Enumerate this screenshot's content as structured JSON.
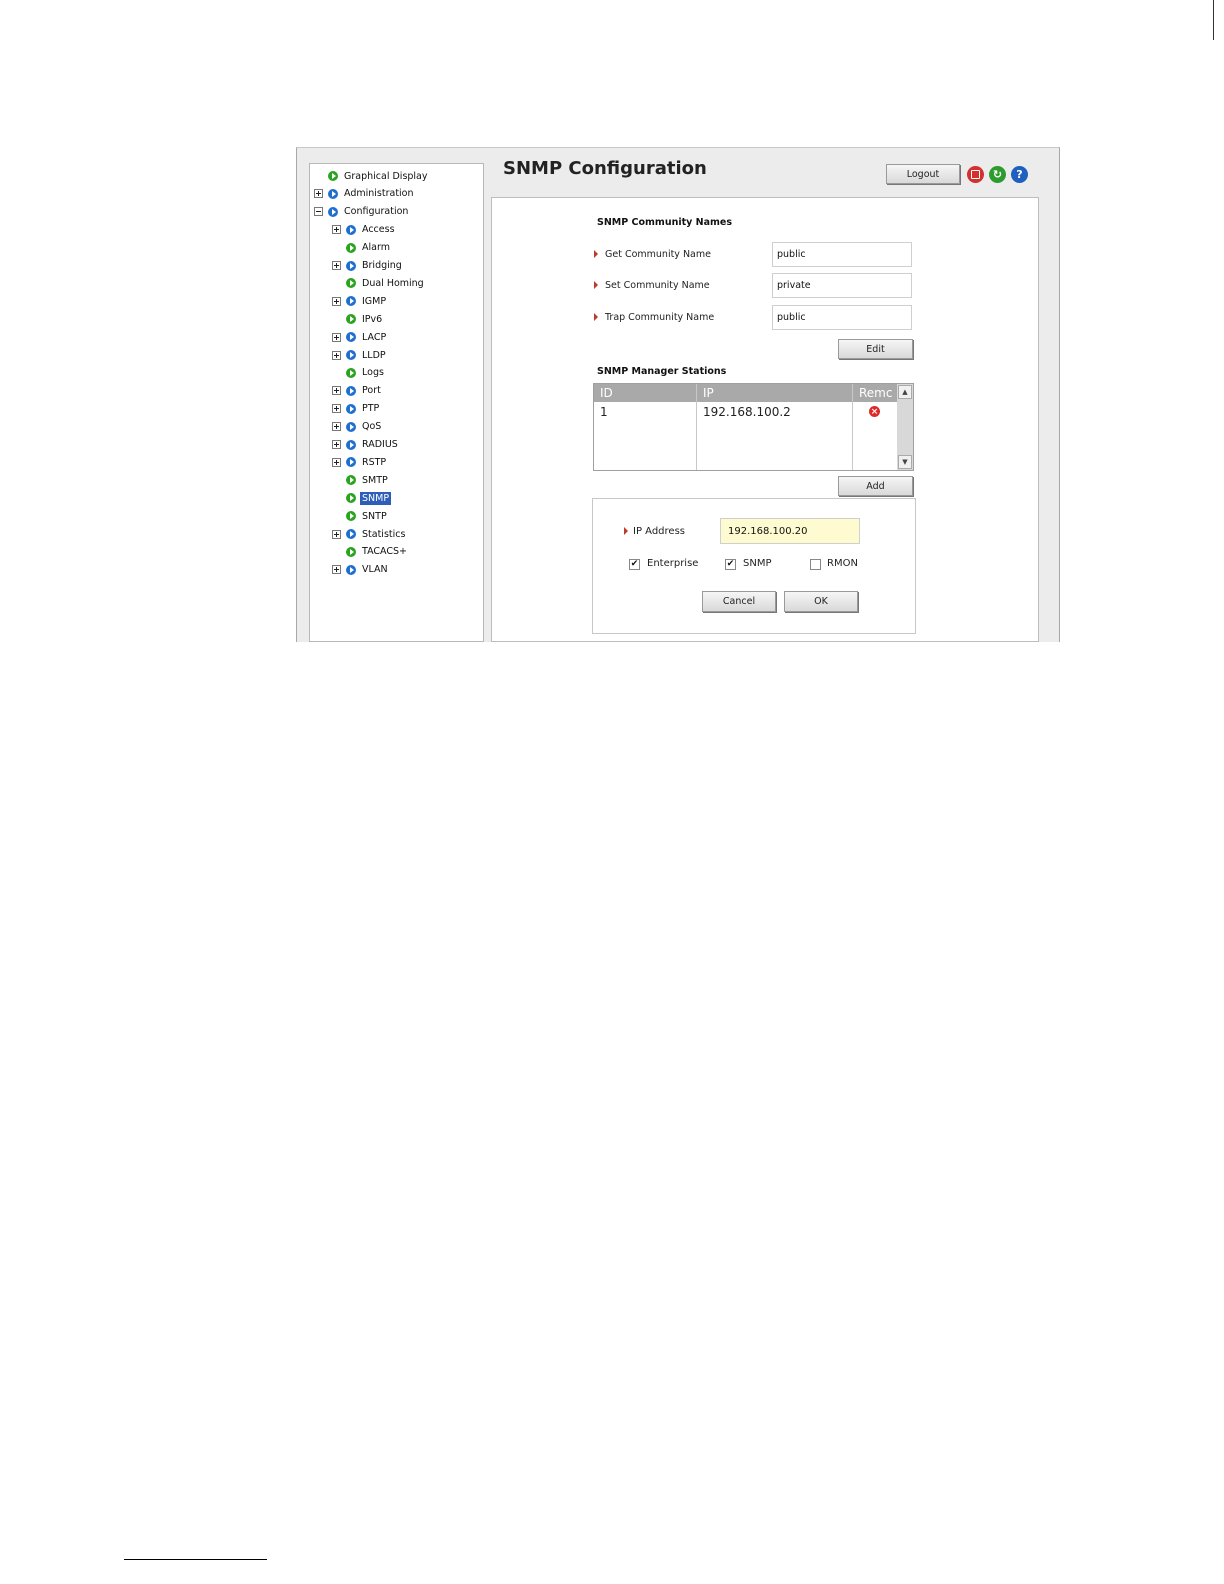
{
  "header": {
    "title": "SNMP Configuration",
    "logout_label": "Logout",
    "icons": [
      "save-icon",
      "refresh-icon",
      "help-icon"
    ],
    "help_glyph": "?",
    "refresh_glyph": "↻"
  },
  "tree": {
    "items": [
      {
        "label": "Graphical Display",
        "level": 0,
        "expander": "none",
        "bullet": "green"
      },
      {
        "label": "Administration",
        "level": 0,
        "expander": "plus",
        "bullet": "blue"
      },
      {
        "label": "Configuration",
        "level": 0,
        "expander": "minus",
        "bullet": "blue"
      },
      {
        "label": "Access",
        "level": 1,
        "expander": "plus",
        "bullet": "blue"
      },
      {
        "label": "Alarm",
        "level": 1,
        "expander": "none",
        "bullet": "green"
      },
      {
        "label": "Bridging",
        "level": 1,
        "expander": "plus",
        "bullet": "blue"
      },
      {
        "label": "Dual Homing",
        "level": 1,
        "expander": "none",
        "bullet": "green"
      },
      {
        "label": "IGMP",
        "level": 1,
        "expander": "plus",
        "bullet": "blue"
      },
      {
        "label": "IPv6",
        "level": 1,
        "expander": "none",
        "bullet": "green"
      },
      {
        "label": "LACP",
        "level": 1,
        "expander": "plus",
        "bullet": "blue"
      },
      {
        "label": "LLDP",
        "level": 1,
        "expander": "plus",
        "bullet": "blue"
      },
      {
        "label": "Logs",
        "level": 1,
        "expander": "none",
        "bullet": "green"
      },
      {
        "label": "Port",
        "level": 1,
        "expander": "plus",
        "bullet": "blue"
      },
      {
        "label": "PTP",
        "level": 1,
        "expander": "plus",
        "bullet": "blue"
      },
      {
        "label": "QoS",
        "level": 1,
        "expander": "plus",
        "bullet": "blue"
      },
      {
        "label": "RADIUS",
        "level": 1,
        "expander": "plus",
        "bullet": "blue"
      },
      {
        "label": "RSTP",
        "level": 1,
        "expander": "plus",
        "bullet": "blue"
      },
      {
        "label": "SMTP",
        "level": 1,
        "expander": "none",
        "bullet": "green"
      },
      {
        "label": "SNMP",
        "level": 1,
        "expander": "none",
        "bullet": "green",
        "selected": true
      },
      {
        "label": "SNTP",
        "level": 1,
        "expander": "none",
        "bullet": "green"
      },
      {
        "label": "Statistics",
        "level": 1,
        "expander": "plus",
        "bullet": "blue"
      },
      {
        "label": "TACACS+",
        "level": 1,
        "expander": "none",
        "bullet": "green"
      },
      {
        "label": "VLAN",
        "level": 1,
        "expander": "plus",
        "bullet": "blue"
      }
    ]
  },
  "community": {
    "heading": "SNMP Community Names",
    "get_label": "Get Community Name",
    "get_value": "public",
    "set_label": "Set Community Name",
    "set_value": "private",
    "trap_label": "Trap Community Name",
    "trap_value": "public",
    "edit_label": "Edit"
  },
  "stations": {
    "heading": "SNMP Manager Stations",
    "columns": [
      "ID",
      "IP",
      "Remc"
    ],
    "rows": [
      {
        "id": "1",
        "ip": "192.168.100.2"
      }
    ],
    "add_label": "Add",
    "scroll_up": "▲",
    "scroll_down": "▼"
  },
  "form": {
    "ip_label": "IP Address",
    "ip_value": "192.168.100.20",
    "check_mark": "✔",
    "checkboxes": [
      {
        "label": "Enterprise",
        "checked": true
      },
      {
        "label": "SNMP",
        "checked": true
      },
      {
        "label": "RMON",
        "checked": false
      }
    ],
    "cancel_label": "Cancel",
    "ok_label": "OK"
  },
  "colors": {
    "selection": "#2d5fb8",
    "ip_field_bg": "#fffbd0",
    "grid_header": "#a9a9a9",
    "arrow": "#c0392b"
  }
}
